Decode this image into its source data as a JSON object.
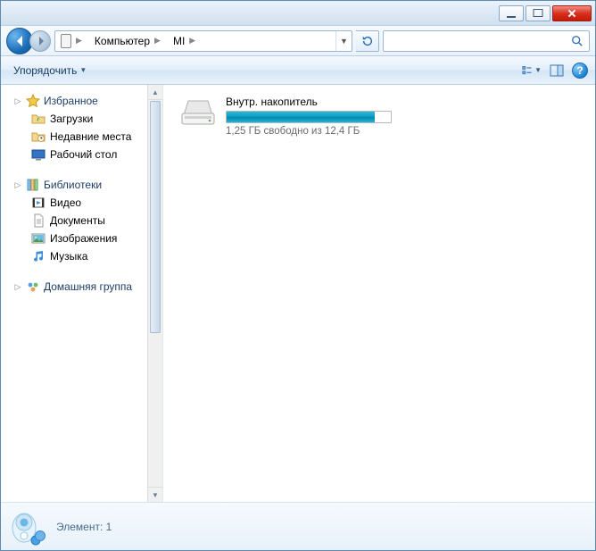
{
  "titlebar": {},
  "nav": {
    "crumbs": [
      "Компьютер",
      "MI"
    ]
  },
  "toolbar": {
    "organize_label": "Упорядочить"
  },
  "sidebar": {
    "groups": [
      {
        "header": "Избранное",
        "items": [
          {
            "label": "Загрузки"
          },
          {
            "label": "Недавние места"
          },
          {
            "label": "Рабочий стол"
          }
        ]
      },
      {
        "header": "Библиотеки",
        "items": [
          {
            "label": "Видео"
          },
          {
            "label": "Документы"
          },
          {
            "label": "Изображения"
          },
          {
            "label": "Музыка"
          }
        ]
      },
      {
        "header": "Домашняя группа",
        "items": []
      }
    ]
  },
  "content": {
    "drive": {
      "title": "Внутр. накопитель",
      "subtitle": "1,25 ГБ свободно из 12,4 ГБ",
      "used_percent": 90
    }
  },
  "status": {
    "text": "Элемент: 1"
  }
}
